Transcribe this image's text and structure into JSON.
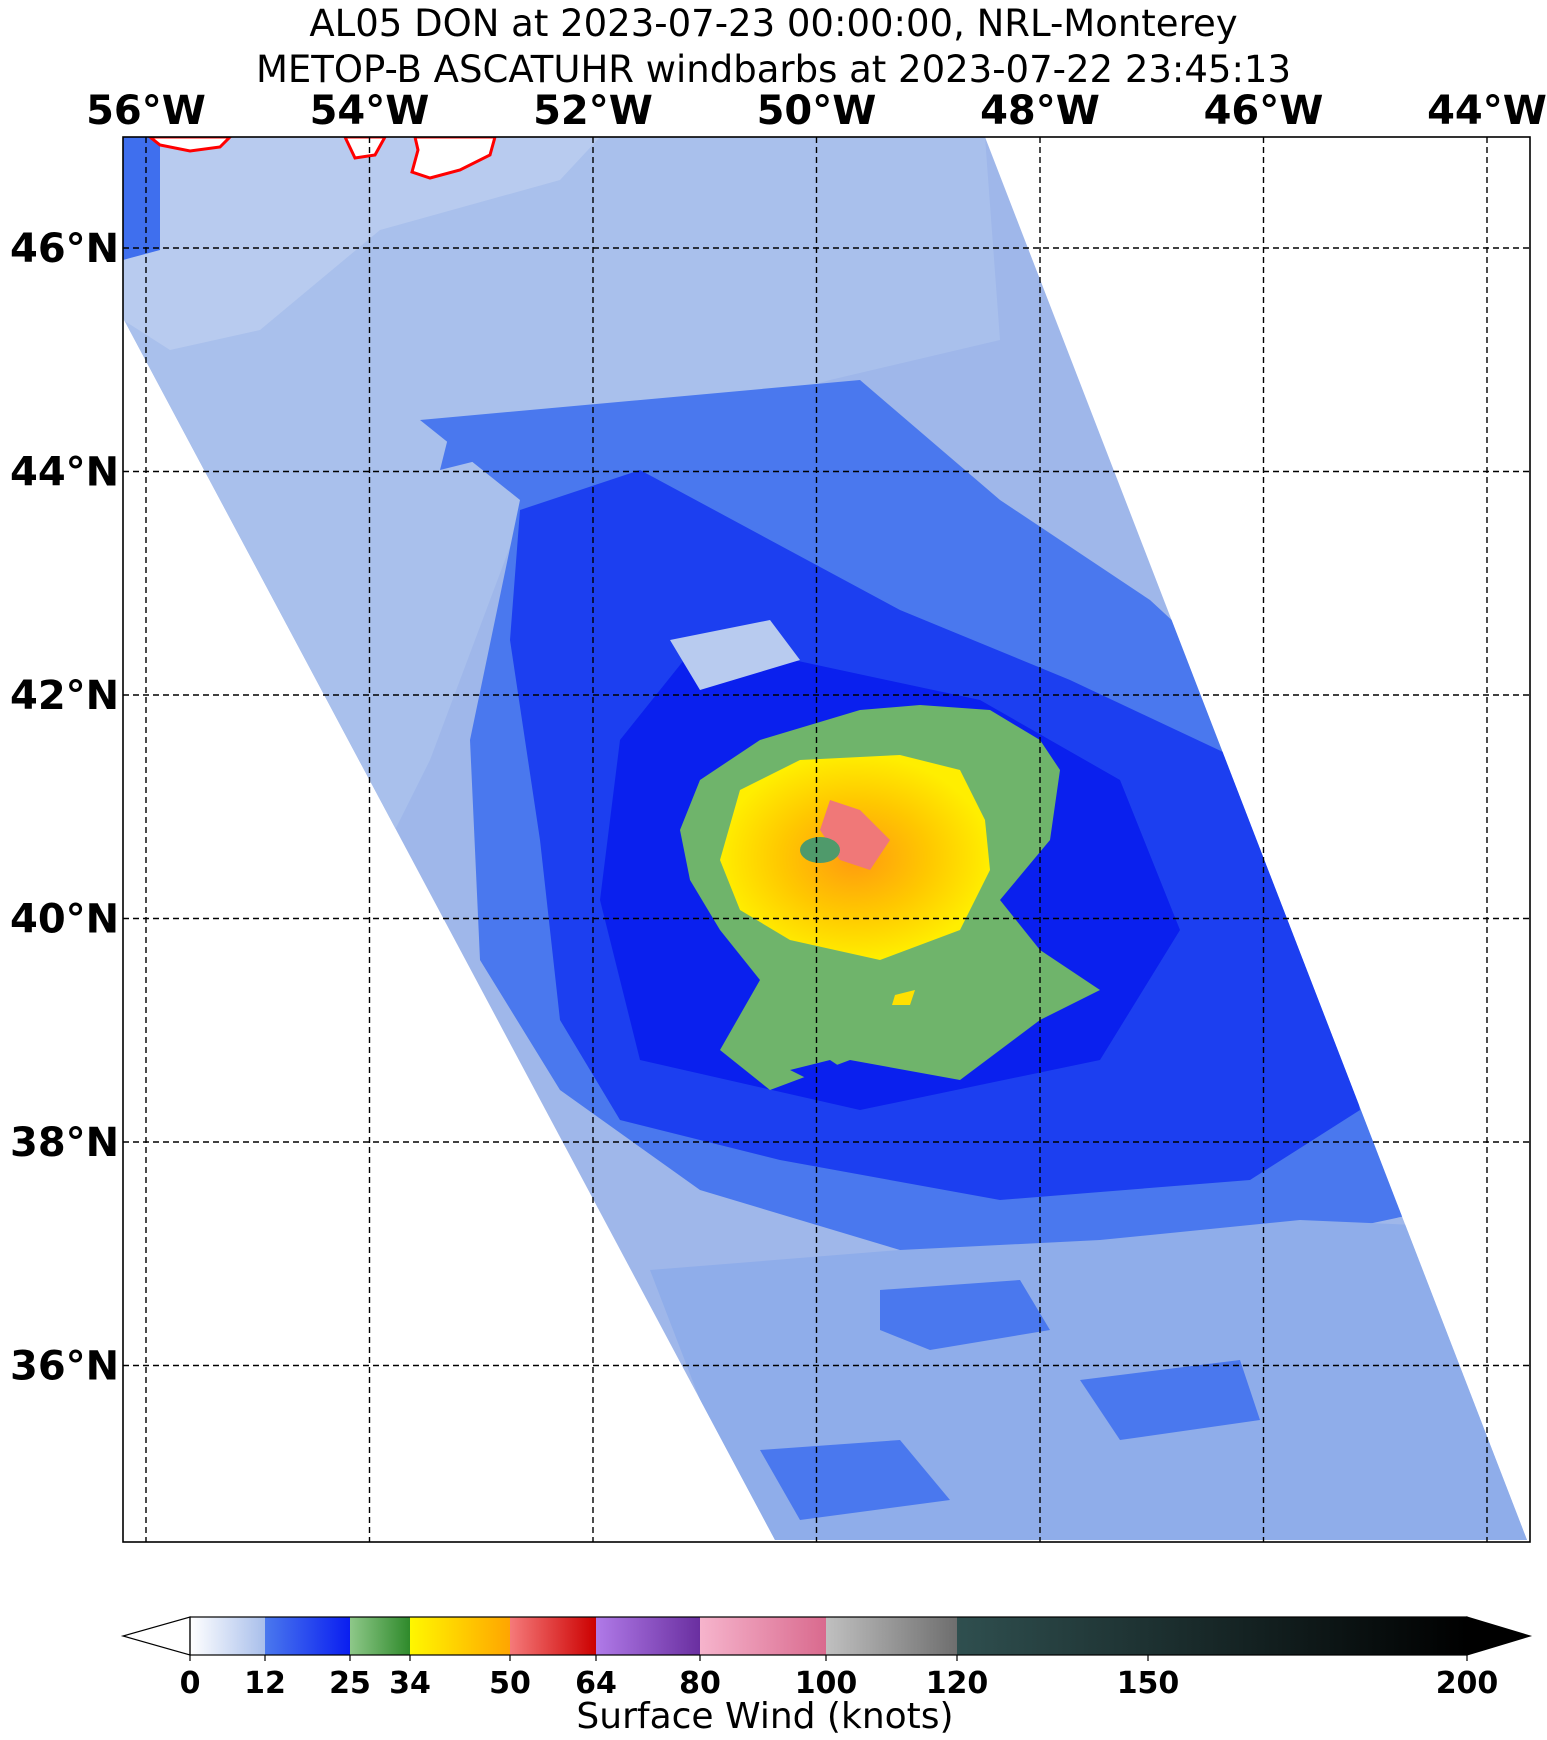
{
  "title": {
    "line1": "AL05 DON at 2023-07-23 00:00:00, NRL-Monterey",
    "line2": "METOP-B ASCATUHR windbarbs at 2023-07-22 23:45:13"
  },
  "map": {
    "lon_labels": [
      "56°W",
      "54°W",
      "52°W",
      "50°W",
      "48°W",
      "46°W",
      "44°W"
    ],
    "lat_labels": [
      "46°N",
      "44°N",
      "42°N",
      "40°N",
      "38°N",
      "36°N"
    ],
    "storm_center": {
      "lon": -49.9,
      "lat": 40.6
    }
  },
  "colorbar": {
    "title": "Surface Wind (knots)",
    "ticks": [
      "0",
      "12",
      "25",
      "34",
      "50",
      "64",
      "80",
      "100",
      "120",
      "150",
      "200"
    ],
    "segments": [
      {
        "from": 0,
        "to": 12,
        "colors": [
          "#ffffff",
          "#a9bfeb"
        ]
      },
      {
        "from": 12,
        "to": 25,
        "colors": [
          "#4a78ee",
          "#0a1ef0"
        ]
      },
      {
        "from": 25,
        "to": 34,
        "colors": [
          "#8ec889",
          "#2f8a2b"
        ]
      },
      {
        "from": 34,
        "to": 50,
        "colors": [
          "#fff700",
          "#ffa500"
        ]
      },
      {
        "from": 50,
        "to": 64,
        "colors": [
          "#f57a7a",
          "#cc0000"
        ]
      },
      {
        "from": 64,
        "to": 80,
        "colors": [
          "#b07ae8",
          "#6a2fa0"
        ]
      },
      {
        "from": 80,
        "to": 100,
        "colors": [
          "#f6b4cc",
          "#d96a8e"
        ]
      },
      {
        "from": 100,
        "to": 120,
        "colors": [
          "#c0c0c0",
          "#6e6e6e"
        ]
      },
      {
        "from": 120,
        "to": 200,
        "colors": [
          "#2f4f4f",
          "#000000"
        ]
      }
    ]
  },
  "colors": {
    "swath_light": "#a9bfeb",
    "swath_mid": "#4a78ee",
    "swath_dark": "#1535f0",
    "ts_green": "#6fb46b",
    "ts_yellow": "#ffd400",
    "ts_orange": "#ffa31a",
    "ts_red": "#f07878",
    "coast": "#ff0000"
  }
}
